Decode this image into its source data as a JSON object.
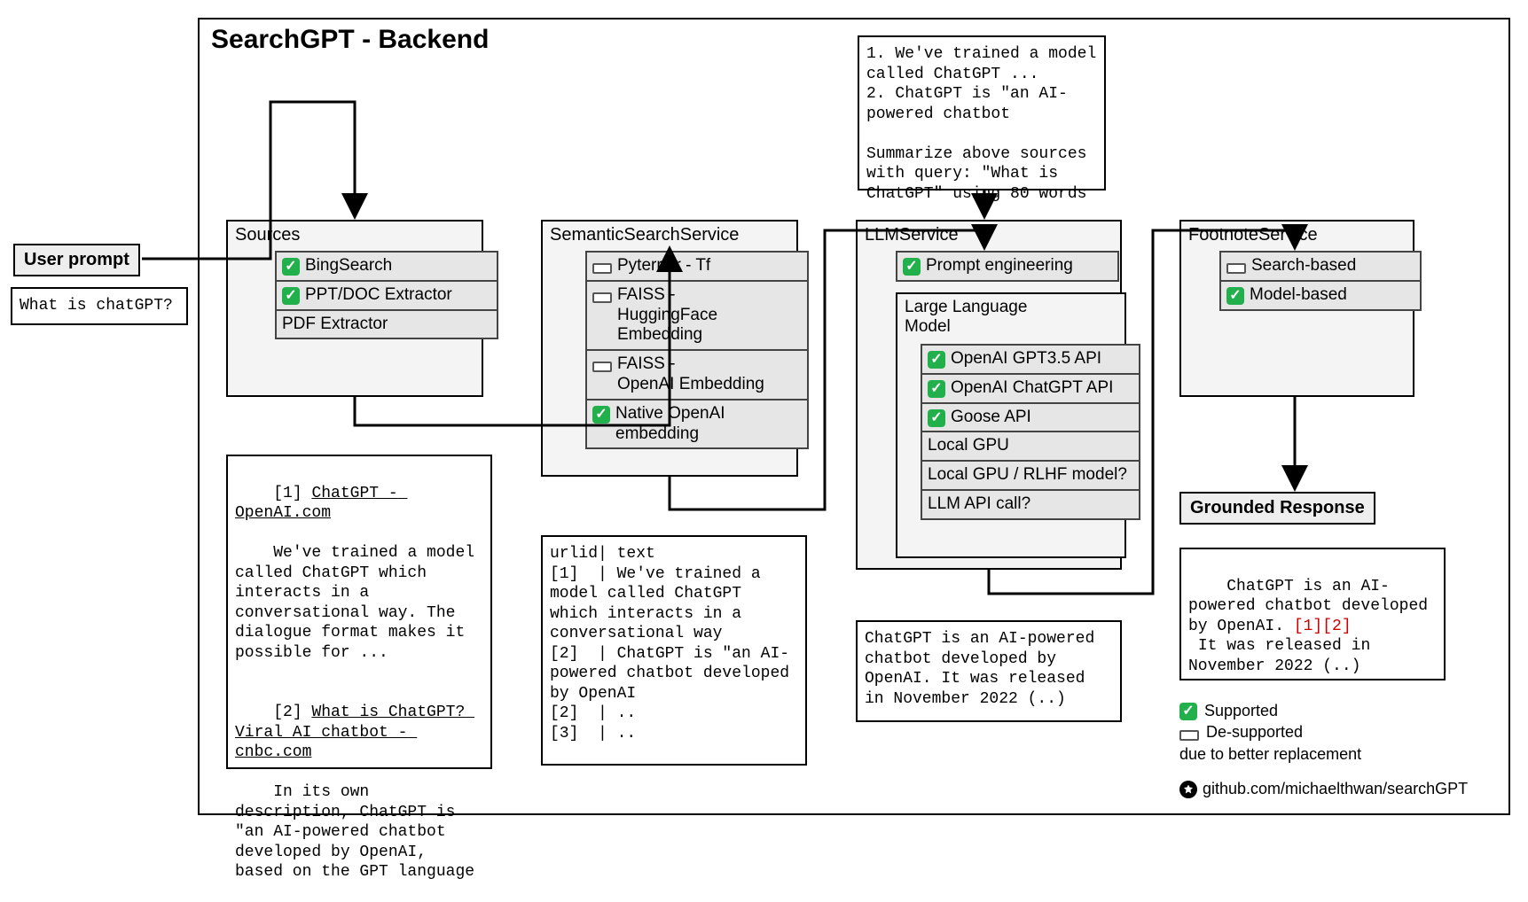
{
  "diagram_title": "SearchGPT - Backend",
  "user_prompt_label": "User prompt",
  "user_prompt_text": "What is chatGPT?",
  "sources": {
    "title": "Sources",
    "items": [
      {
        "status": "check",
        "label": "BingSearch"
      },
      {
        "status": "check",
        "label": "PPT/DOC Extractor"
      },
      {
        "status": "none",
        "label": "PDF Extractor"
      }
    ]
  },
  "sources_output": "[1] ChatGPT - OpenAI.com\nWe've trained a model called ChatGPT which interacts in a conversational way. The dialogue format makes it possible for ...\n\n[2] What is ChatGPT? Viral AI chatbot - cnbc.com\nIn its own description, ChatGPT is \"an AI-powered chatbot developed by OpenAI, based on the GPT language",
  "semantic": {
    "title": "SemanticSearchService",
    "items": [
      {
        "status": "minus",
        "label": "Pyterrier - Tf"
      },
      {
        "status": "minus",
        "label": "FAISS -\nHuggingFace Embedding"
      },
      {
        "status": "minus",
        "label": "FAISS -\nOpenAI Embedding"
      },
      {
        "status": "check",
        "label": "Native OpenAI\nembedding"
      }
    ]
  },
  "semantic_output": "urlid| text\n[1]  | We've trained a model called ChatGPT which interacts in a conversational way\n[2]  | ChatGPT is \"an AI-powered chatbot developed by OpenAI\n[2]  | ..\n[3]  | ..",
  "llm_prompt_above": "1. We've trained a model called ChatGPT ...\n2. ChatGPT is \"an AI-powered chatbot\n\nSummarize above sources with query: \"What is ChatGPT\" using 80 words",
  "llm": {
    "title": "LLMService",
    "prompt_eng": {
      "status": "check",
      "label": "Prompt engineering"
    },
    "inner_title": "Large Language\nModel",
    "items": [
      {
        "status": "check",
        "label": "OpenAI GPT3.5 API"
      },
      {
        "status": "check",
        "label": "OpenAI ChatGPT API"
      },
      {
        "status": "check",
        "label": "Goose API"
      },
      {
        "status": "none",
        "label": "Local GPU"
      },
      {
        "status": "none",
        "label": "Local GPU / RLHF model?"
      },
      {
        "status": "none",
        "label": "LLM API call?"
      }
    ]
  },
  "llm_output": "ChatGPT is an AI-powered chatbot developed by OpenAI. It was released in November 2022 (..)",
  "footnote": {
    "title": "FootnoteService",
    "items": [
      {
        "status": "minus",
        "label": "Search-based"
      },
      {
        "status": "check",
        "label": "Model-based"
      }
    ]
  },
  "grounded_label": "Grounded Response",
  "grounded_output_pre": "ChatGPT is an AI-powered chatbot developed by OpenAI.",
  "grounded_output_refs": " [1][2]",
  "grounded_output_post": "\n It was released in November 2022 (..)",
  "legend": {
    "supported": "Supported",
    "desupported": "De-supported",
    "note": "due to better replacement"
  },
  "github": "github.com/michaelthwan/searchGPT"
}
